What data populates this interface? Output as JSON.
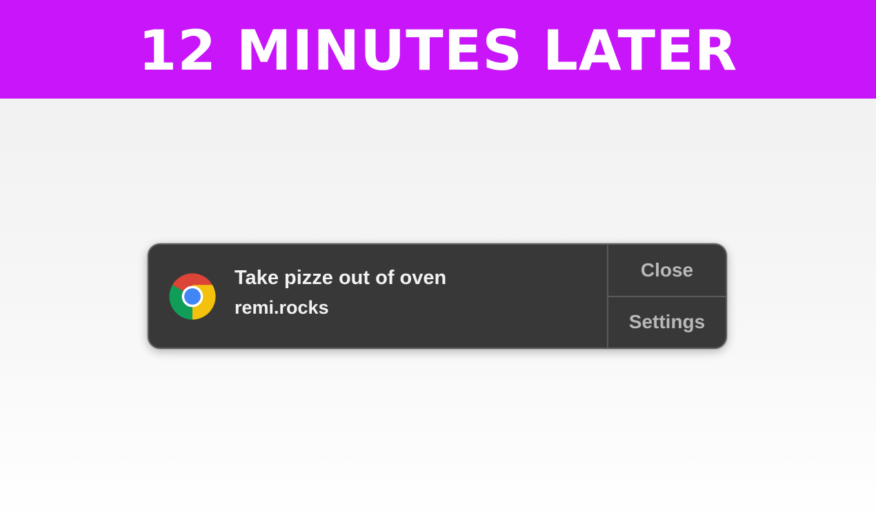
{
  "banner": {
    "title": "12 MINUTES LATER",
    "background_color": "#c815fa"
  },
  "notification": {
    "app_icon": "chrome-icon",
    "title": "Take pizze out of oven",
    "subtitle": "remi.rocks",
    "actions": [
      {
        "label": "Close"
      },
      {
        "label": "Settings"
      }
    ]
  }
}
